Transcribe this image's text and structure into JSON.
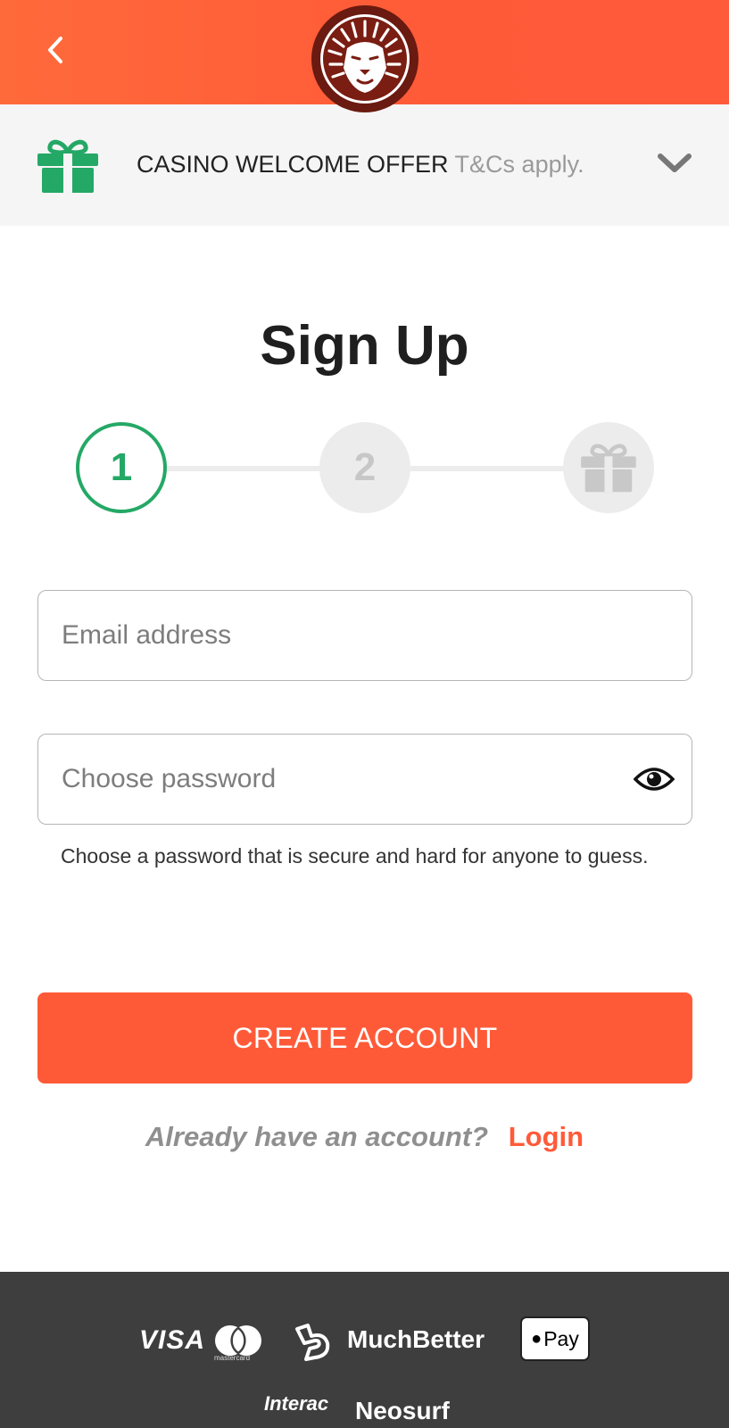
{
  "header": {
    "back_icon": "chevron-left-icon",
    "logo_icon": "lion-logo-icon"
  },
  "offer": {
    "icon": "gift-icon",
    "title": "CASINO WELCOME OFFER",
    "terms": "T&Cs apply.",
    "expand_icon": "chevron-down-icon"
  },
  "page_title": "Sign Up",
  "stepper": {
    "steps": [
      {
        "label": "1",
        "state": "active"
      },
      {
        "label": "2",
        "state": "inactive"
      },
      {
        "label": "",
        "icon": "gift-icon",
        "state": "inactive"
      }
    ],
    "active_color": "#24a866",
    "inactive_color": "#ececec"
  },
  "form": {
    "email": {
      "placeholder": "Email address",
      "value": ""
    },
    "password": {
      "placeholder": "Choose password",
      "value": "",
      "toggle_icon": "eye-icon"
    },
    "password_hint": "Choose a password that is secure and hard for anyone to guess.",
    "submit_label": "CREATE ACCOUNT"
  },
  "login_prompt": {
    "text": "Already have an account?",
    "link": "Login"
  },
  "footer": {
    "payment_methods": {
      "visa": "VISA",
      "mastercard": "mastercard",
      "muchbetter": "MuchBetter",
      "applepay": "Pay",
      "interac": "Interac",
      "neosurf": "Neosurf"
    }
  },
  "colors": {
    "brand": "#ff5a38",
    "success": "#24a866",
    "footer_bg": "#3e3e3e"
  }
}
